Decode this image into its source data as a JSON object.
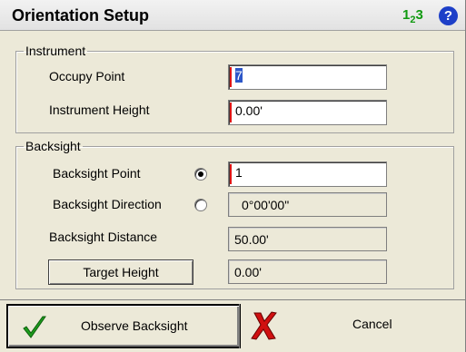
{
  "window": {
    "title": "Orientation Setup",
    "icons": {
      "keypad": "keypad-123-icon",
      "help": "help-question-icon",
      "keypad_glyphs": [
        "1",
        "2",
        "3"
      ],
      "help_glyph": "?"
    }
  },
  "instrument": {
    "legend": "Instrument",
    "occupy_point_label": "Occupy Point",
    "occupy_point_value": "7",
    "instrument_height_label": "Instrument Height",
    "instrument_height_value": "0.00'"
  },
  "backsight": {
    "legend": "Backsight",
    "backsight_point_label": "Backsight Point",
    "backsight_point_selected": true,
    "backsight_point_value": "1",
    "backsight_direction_label": "Backsight Direction",
    "backsight_direction_selected": false,
    "backsight_direction_value": "0°00'00\"",
    "backsight_distance_label": "Backsight Distance",
    "backsight_distance_value": "50.00'",
    "target_height_button_label": "Target Height",
    "target_height_value": "0.00'"
  },
  "actions": {
    "observe_label": "Observe Backsight",
    "observe_icon": "green-check-icon",
    "cancel_label": "Cancel",
    "cancel_icon": "red-x-icon"
  },
  "colors": {
    "check_green": "#1c9c1c",
    "cancel_red": "#d01010",
    "help_blue": "#1d3fc8",
    "keypad_green": "#119a11",
    "selection_blue": "#2d57c8"
  }
}
